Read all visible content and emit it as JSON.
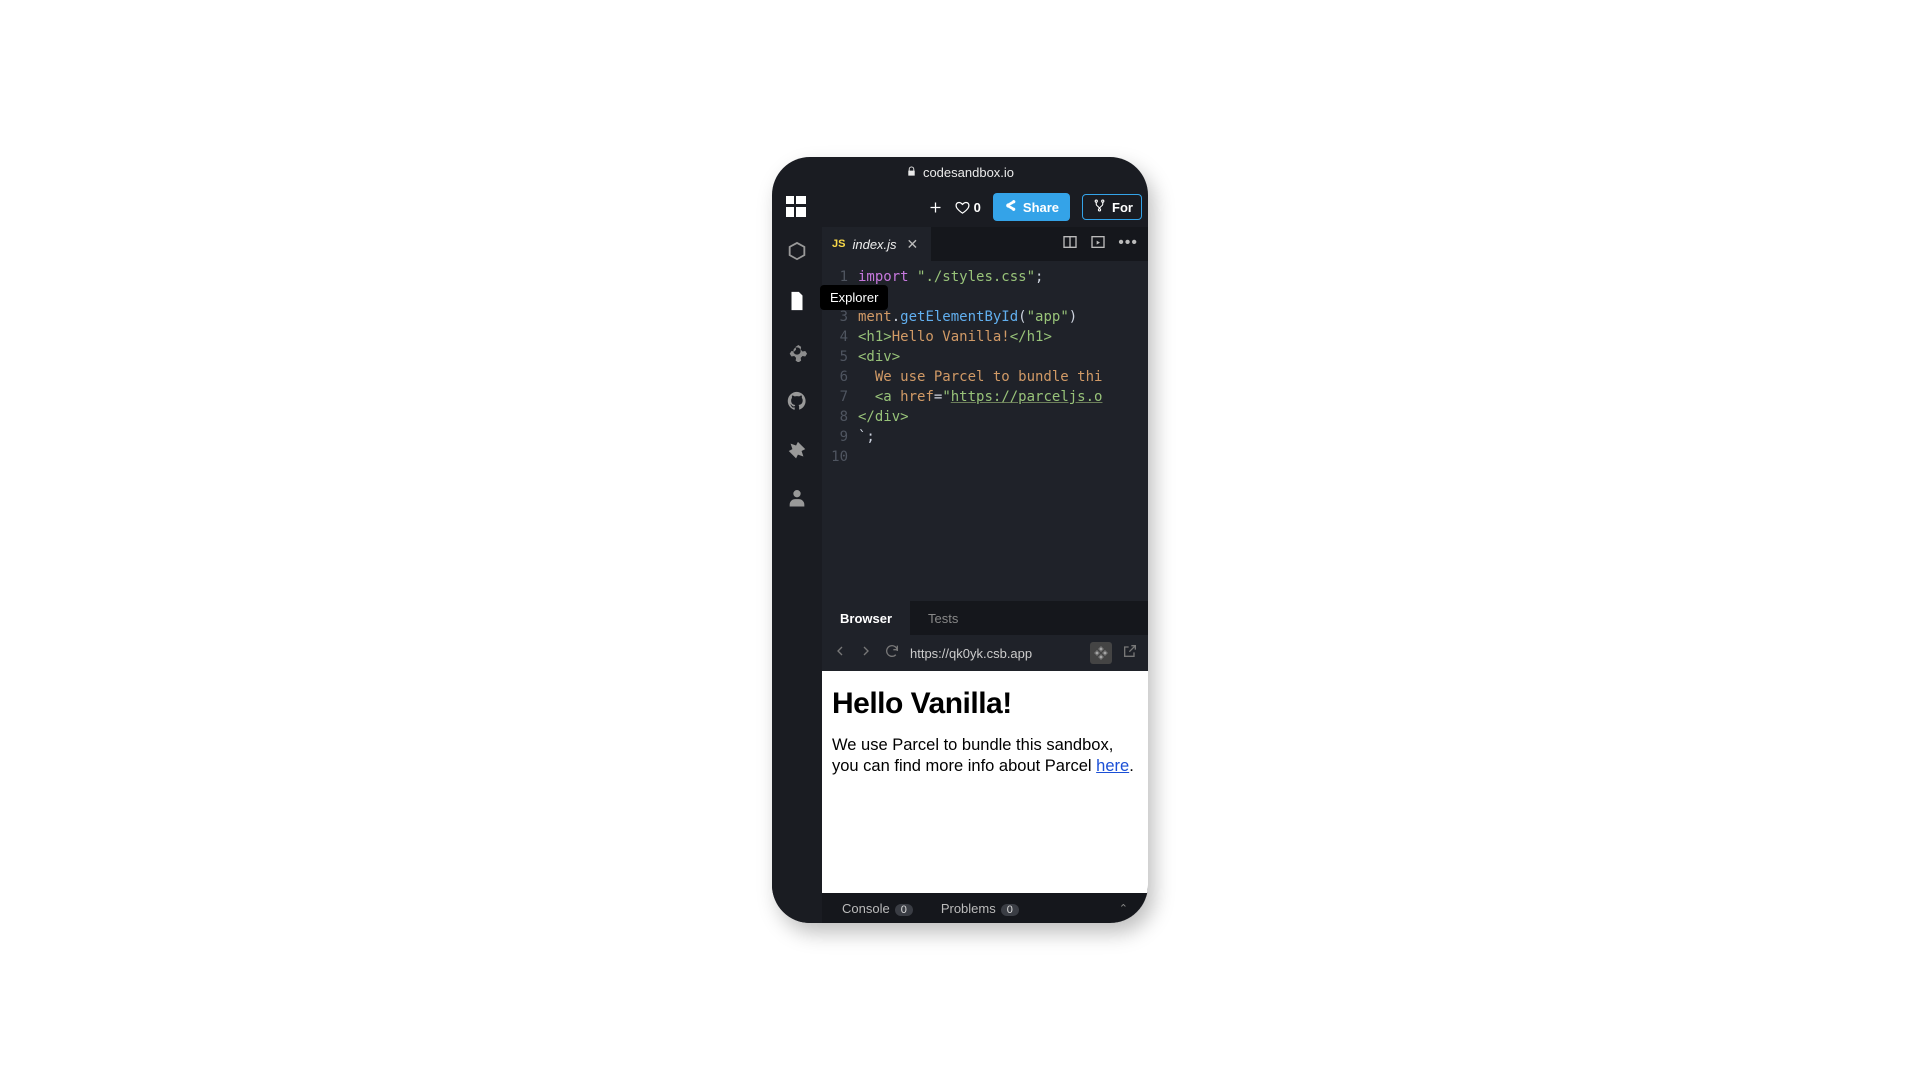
{
  "address_bar": {
    "host": "codesandbox.io"
  },
  "topbar": {
    "likes": "0",
    "share_label": "Share",
    "fork_label": "For"
  },
  "rail": {
    "tooltip": "Explorer"
  },
  "tab": {
    "filetype": "JS",
    "filename": "index.js"
  },
  "code": {
    "lines": [
      {
        "n": "1",
        "html": "<span class='kw'>import</span> <span class='str'>\"./styles.css\"</span>;"
      },
      {
        "n": "2",
        "html": ""
      },
      {
        "n": "3",
        "html": "<span class='prop'>ment</span>.<span class='fn'>getElementById</span>(<span class='str'>\"app\"</span>)"
      },
      {
        "n": "4",
        "html": "<span class='tag'>&lt;h1&gt;</span><span class='txt'>Hello Vanilla!</span><span class='tag'>&lt;/h1&gt;</span>"
      },
      {
        "n": "5",
        "html": "<span class='tag'>&lt;div&gt;</span>"
      },
      {
        "n": "6",
        "html": "  <span class='txt'>We use Parcel to bundle thi</span>"
      },
      {
        "n": "7",
        "html": "  <span class='tag'>&lt;a</span> <span class='prop'>href</span>=<span class='str'>\"</span><span class='url'>https://parceljs.o</span>"
      },
      {
        "n": "8",
        "html": "<span class='tag'>&lt;/div&gt;</span>"
      },
      {
        "n": "9",
        "html": "`;"
      },
      {
        "n": "10",
        "html": ""
      }
    ]
  },
  "preview_tabs": {
    "browser": "Browser",
    "tests": "Tests"
  },
  "preview_url": "https://qk0yk.csb.app",
  "preview": {
    "heading": "Hello Vanilla!",
    "text_a": "We use Parcel to bundle this sandbox, you can find more info about Parcel ",
    "link": "here",
    "text_b": "."
  },
  "bottom": {
    "console": "Console",
    "console_count": "0",
    "problems": "Problems",
    "problems_count": "0"
  }
}
